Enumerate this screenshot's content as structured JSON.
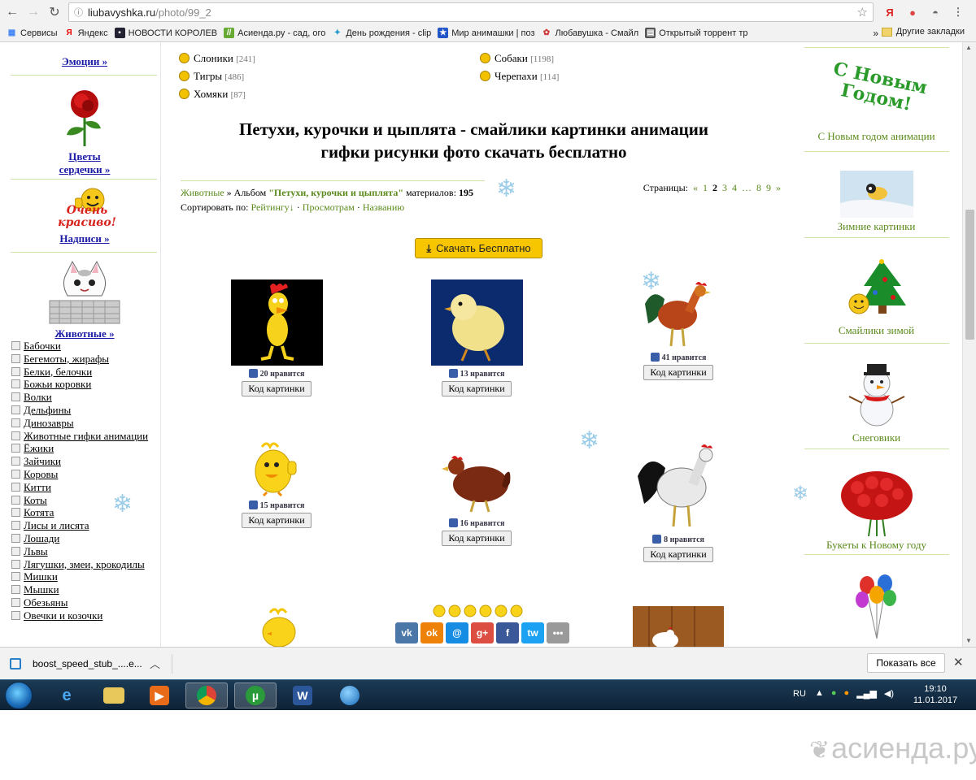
{
  "browser": {
    "url_host": "liubavyshka.ru",
    "url_path": "/photo/99_2",
    "back_icon": "arrow-left-icon",
    "forward_icon": "arrow-right-icon",
    "reload_icon": "reload-icon"
  },
  "bookmarks": {
    "items": [
      "Сервисы",
      "Яндекс",
      "НОВОСТИ КОРОЛЕВ",
      "Асиенда.ру - сад, ого",
      "День рождения - clip",
      "Мир анимашки | поз",
      "Любавушка - Смайл",
      "Открытый торрент тр"
    ],
    "more": "»",
    "other": "Другие закладки"
  },
  "left": {
    "emotions": "Эмоции »",
    "flowers_line1": "Цветы",
    "flowers_line2": "сердечки »",
    "ochen_line1": "Очень",
    "ochen_line2": "красиво!",
    "inscriptions": "Надписи »",
    "animals": "Животные »",
    "animal_list": [
      "Бабочки",
      "Бегемоты, жирафы",
      "Белки, белочки",
      "Божьи коровки",
      "Волки",
      "Дельфины",
      "Динозавры",
      "Животные гифки анимации",
      "Ёжики",
      "Зайчики",
      "Коровы",
      "Китти",
      "Коты",
      "Котята",
      "Лисы и лисята",
      "Лошади",
      "Львы",
      "Лягушки, змеи, крокодилы",
      "Мишки",
      "Мышки",
      "Обезьяны",
      "Овечки и козочки"
    ]
  },
  "main": {
    "cats_left": [
      {
        "name": "Слоники",
        "count": "[241]"
      },
      {
        "name": "Тигры",
        "count": "[486]"
      },
      {
        "name": "Хомяки",
        "count": "[87]"
      }
    ],
    "cats_right": [
      {
        "name": "Собаки",
        "count": "[1198]"
      },
      {
        "name": "Черепахи",
        "count": "[114]"
      }
    ],
    "title_line1": "Петухи, курочки и цыплята - смайлики картинки анимации",
    "title_line2": "гифки рисунки фото скачать бесплатно",
    "crumb_root": "Животные",
    "crumb_sep": " » Альбом ",
    "crumb_album": "\"Петухи, курочки и цыплята\"",
    "crumb_materials": " материалов: ",
    "crumb_count": "195",
    "sort_label": "Сортировать по: ",
    "sort_rating": "Рейтингу↓",
    "sort_views": "Просмотрам",
    "sort_name": "Названию",
    "pages_label": "Страницы:",
    "pages_prev": "«",
    "pages": [
      "1",
      "2",
      "3",
      "4",
      "…",
      "8",
      "9"
    ],
    "pages_current": "2",
    "pages_next": "»",
    "download_label": "Скачать Бесплатно",
    "code_label": "Код картинки",
    "likes_suffix": " нравится",
    "images": [
      {
        "likes": "20",
        "desc": "rooster-cartoon-icon"
      },
      {
        "likes": "13",
        "desc": "chick-photo-icon"
      },
      {
        "likes": "41",
        "desc": "rooster-photo-icon"
      },
      {
        "likes": "15",
        "desc": "chick-thumbsup-icon"
      },
      {
        "likes": "16",
        "desc": "hen-photo-icon"
      },
      {
        "likes": "8",
        "desc": "rooster-white-icon"
      }
    ],
    "share": [
      "vk",
      "ok",
      "@",
      "g+",
      "f",
      "tw",
      "•••"
    ]
  },
  "right": {
    "new_year_line1": "С Новым",
    "new_year_line2": "Годом!",
    "items": [
      "С Новым годом анимации",
      "Зимние картинки",
      "Смайлики зимой",
      "Снеговики",
      "Букеты к Новому году"
    ]
  },
  "shelf": {
    "file": "boost_speed_stub_....e...",
    "show_all": "Показать все"
  },
  "taskbar": {
    "lang": "RU",
    "time": "19:10",
    "date": "11.01.2017"
  },
  "watermark": "асиенда.ру",
  "colors": {
    "link_green": "#5a8a1a",
    "link_blue": "#1a1aa6",
    "download_yellow": "#f7c600"
  }
}
